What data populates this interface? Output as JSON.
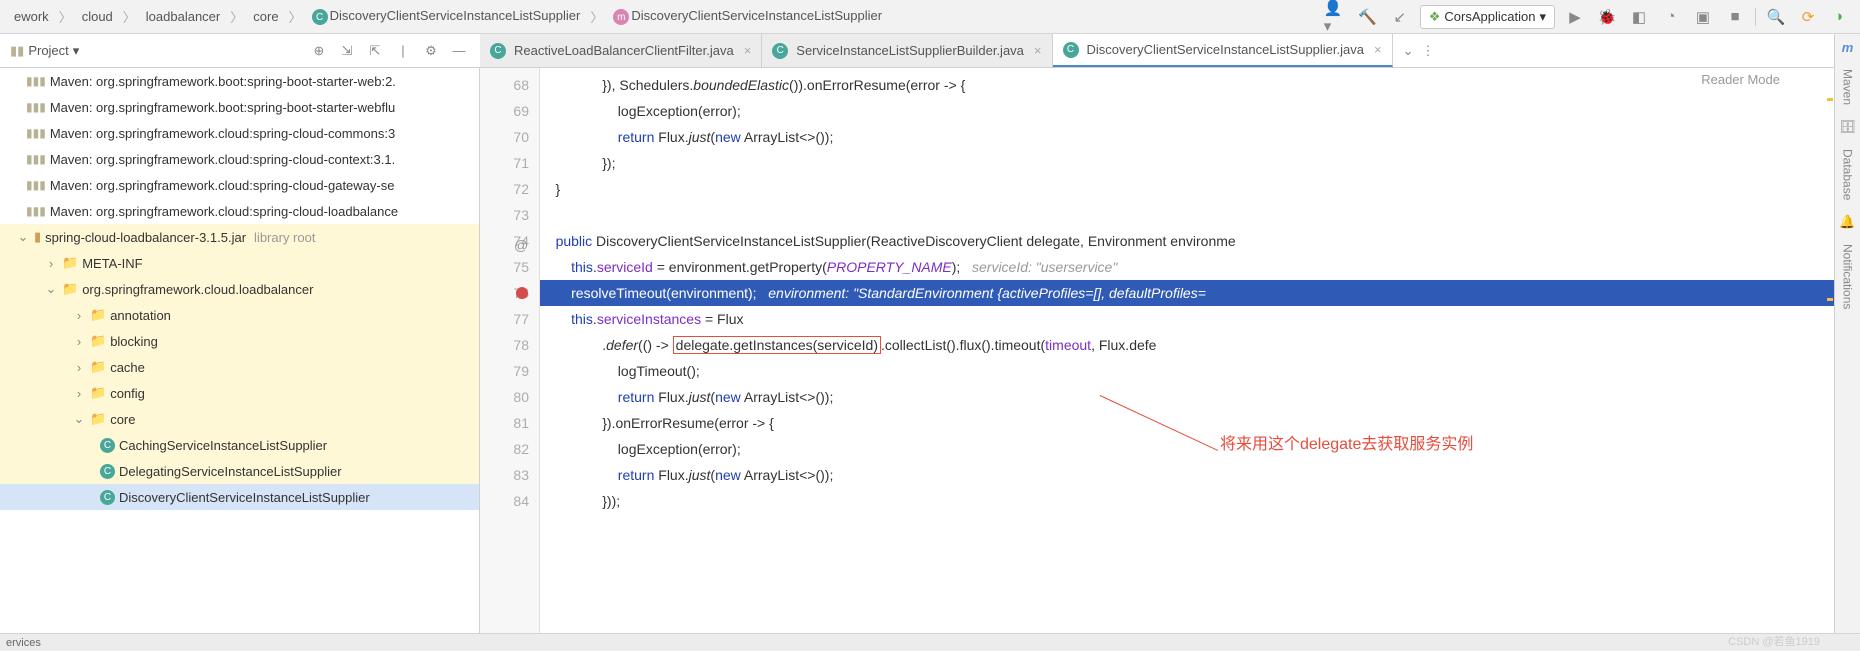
{
  "breadcrumbs": [
    "ework",
    "cloud",
    "loadbalancer",
    "core",
    "DiscoveryClientServiceInstanceListSupplier",
    "DiscoveryClientServiceInstanceListSupplier"
  ],
  "runConfig": "CorsApplication",
  "projectPanel": {
    "title": "Project"
  },
  "tree": {
    "libs": [
      "Maven: org.springframework.boot:spring-boot-starter-web:2.",
      "Maven: org.springframework.boot:spring-boot-starter-webflu",
      "Maven: org.springframework.cloud:spring-cloud-commons:3",
      "Maven: org.springframework.cloud:spring-cloud-context:3.1.",
      "Maven: org.springframework.cloud:spring-cloud-gateway-se",
      "Maven: org.springframework.cloud:spring-cloud-loadbalance"
    ],
    "jar": {
      "name": "spring-cloud-loadbalancer-3.1.5.jar",
      "note": "library root"
    },
    "pkg": "org.springframework.cloud.loadbalancer",
    "folders": [
      "META-INF",
      "annotation",
      "blocking",
      "cache",
      "config",
      "core"
    ],
    "classes": [
      "CachingServiceInstanceListSupplier",
      "DelegatingServiceInstanceListSupplier",
      "DiscoveryClientServiceInstanceListSupplier"
    ]
  },
  "tabs": [
    {
      "name": "ReactiveLoadBalancerClientFilter.java",
      "active": false
    },
    {
      "name": "ServiceInstanceListSupplierBuilder.java",
      "active": false
    },
    {
      "name": "DiscoveryClientServiceInstanceListSupplier.java",
      "active": true
    }
  ],
  "readerMode": "Reader Mode",
  "gutter": {
    "start": 68,
    "end": 84,
    "breakpoint": 76,
    "annotated": 74
  },
  "code": {
    "l68": {
      "pre": "                }), Schedulers.",
      "m": "boundedElastic",
      "post": "()).onErrorResume(error -> {"
    },
    "l69": "                    logException(error);",
    "l70": {
      "kw": "return",
      "pre": " Flux.",
      "m": "just",
      "mid": "(",
      "kw2": "new",
      "post": " ArrayList<>());"
    },
    "l71": "                });",
    "l72": "    }",
    "l73": "",
    "l74": {
      "kw": "public",
      "cls": "DiscoveryClientServiceInstanceListSupplier",
      "params": "(ReactiveDiscoveryClient delegate, Environment environme"
    },
    "l75": {
      "kw": "this",
      "f": "serviceId",
      "mid": " = environment.getProperty(",
      "c": "PROPERTY_NAME",
      "end": ");",
      "cmt": "   serviceId: \"userservice\""
    },
    "l76": {
      "call": "resolveTimeout(environment);",
      "cmt": "   environment: \"StandardEnvironment {activeProfiles=[], defaultProfiles="
    },
    "l77": {
      "kw": "this",
      "f": "serviceInstances",
      "post": " = Flux"
    },
    "l78": {
      "pre": "                .",
      "m": "defer",
      "mid": "(() -> ",
      "box": "delegate.getInstances(serviceId)",
      "post": ".collectList().flux().timeout(",
      "f": "timeout",
      "end": ", Flux.defe"
    },
    "l79": "                    logTimeout();",
    "l80": {
      "kw": "return",
      "pre": " Flux.",
      "m": "just",
      "mid": "(",
      "kw2": "new",
      "post": " ArrayList<>());"
    },
    "l81": "                }).onErrorResume(error -> {",
    "l82": "                    logException(error);",
    "l83": {
      "kw": "return",
      "pre": " Flux.",
      "m": "just",
      "mid": "(",
      "kw2": "new",
      "post": " ArrayList<>());"
    },
    "l84": "                }));"
  },
  "annotation": "将来用这个delegate去获取服务实例",
  "rightTools": [
    "Maven",
    "Database",
    "Notifications"
  ],
  "status": "ervices",
  "watermark": "CSDN @若鱼1919"
}
